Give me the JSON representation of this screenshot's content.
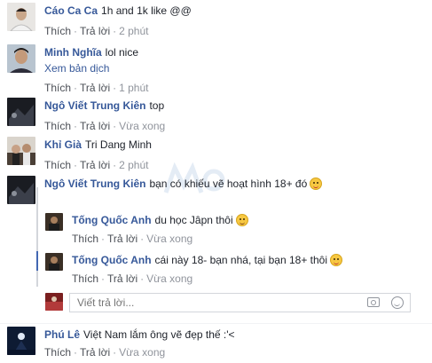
{
  "comments": [
    {
      "author": "Cáo Ca Ca",
      "text": "1h and 1k like @@",
      "actions": {
        "like": "Thích",
        "reply": "Trả lời",
        "time": "2 phút"
      }
    },
    {
      "author": "Minh Nghĩa",
      "text": "lol nice",
      "translate": "Xem bản dịch",
      "actions": {
        "like": "Thích",
        "reply": "Trả lời",
        "time": "1 phút"
      }
    },
    {
      "author": "Ngô Viết Trung Kiên",
      "text": "top",
      "actions": {
        "like": "Thích",
        "reply": "Trả lời",
        "time": "Vừa xong"
      }
    },
    {
      "author": "Khỉ Già",
      "text": "Tri Dang Minh",
      "actions": {
        "like": "Thích",
        "reply": "Trả lời",
        "time": "2 phút"
      }
    },
    {
      "author": "Ngô Viết Trung Kiên",
      "text": "bạn có khiếu vẽ hoạt hình 18+ đó",
      "emoji": "tongue-emoji",
      "actions": {
        "like": "Thích",
        "reply": "Trả lời",
        "time": "Vừa xong"
      }
    }
  ],
  "replies": [
    {
      "author": "Tống Quốc Anh",
      "text": "du học Jâpn thôi",
      "emoji": "grin-emoji",
      "actions": {
        "like": "Thích",
        "reply": "Trả lời",
        "time": "Vừa xong"
      }
    },
    {
      "author": "Tống Quốc Anh",
      "text": "cái này 18- bạn nhá, tại bạn 18+ thôi",
      "emoji": "tongue-emoji",
      "actions": {
        "like": "Thích",
        "reply": "Trả lời",
        "time": "Vừa xong"
      }
    }
  ],
  "reply_box": {
    "placeholder": "Viết trả lời...",
    "icons": [
      "camera-icon",
      "smiley-icon"
    ]
  },
  "last_comment": {
    "author": "Phú Lê",
    "text": "Việt Nam lắm ông vẽ đẹp thế :'<",
    "actions": {
      "like": "Thích",
      "reply": "Trả lời",
      "time": "Vừa xong"
    }
  },
  "colors": {
    "author": "#365899",
    "meta": "#90949c",
    "thread_line": "#d3d6db",
    "active_line": "#4267b2"
  }
}
